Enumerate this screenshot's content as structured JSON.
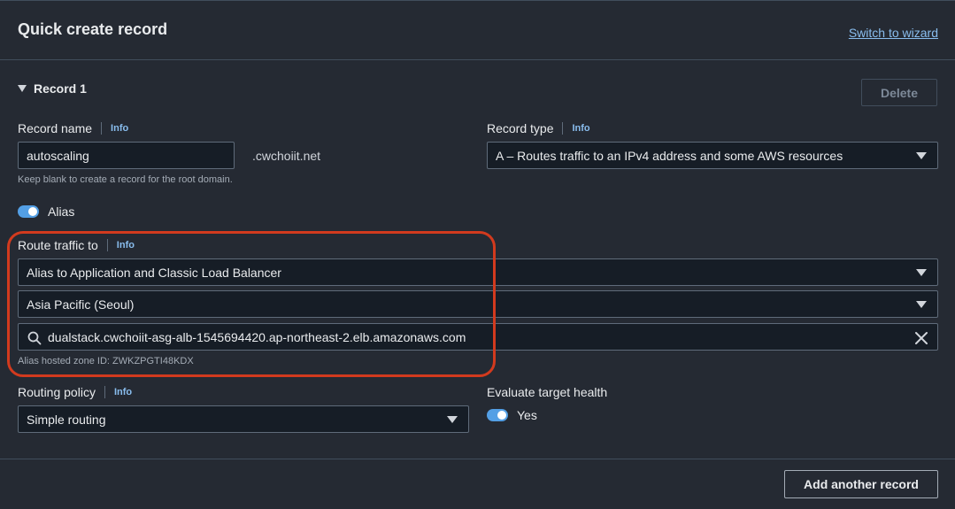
{
  "header": {
    "title": "Quick create record",
    "switch_link": "Switch to wizard"
  },
  "record": {
    "section_label": "Record 1",
    "delete_label": "Delete",
    "record_name": {
      "label": "Record name",
      "info": "Info",
      "value": "autoscaling",
      "suffix": ".cwchoiit.net",
      "hint": "Keep blank to create a record for the root domain."
    },
    "record_type": {
      "label": "Record type",
      "info": "Info",
      "value": "A – Routes traffic to an IPv4 address and some AWS resources"
    },
    "alias": {
      "label": "Alias",
      "enabled": true
    },
    "route_traffic": {
      "label": "Route traffic to",
      "info": "Info",
      "endpoint": "Alias to Application and Classic Load Balancer",
      "region": "Asia Pacific (Seoul)",
      "load_balancer": "dualstack.cwchoiit-asg-alb-1545694420.ap-northeast-2.elb.amazonaws.com",
      "zone_hint": "Alias hosted zone ID: ZWKZPGTI48KDX"
    },
    "routing_policy": {
      "label": "Routing policy",
      "info": "Info",
      "value": "Simple routing"
    },
    "evaluate_health": {
      "label": "Evaluate target health",
      "toggle_label": "Yes",
      "enabled": true
    }
  },
  "footer": {
    "add_label": "Add another record"
  },
  "colors": {
    "accent": "#539fe5",
    "link": "#89bdee",
    "highlight": "#d23a1e"
  }
}
